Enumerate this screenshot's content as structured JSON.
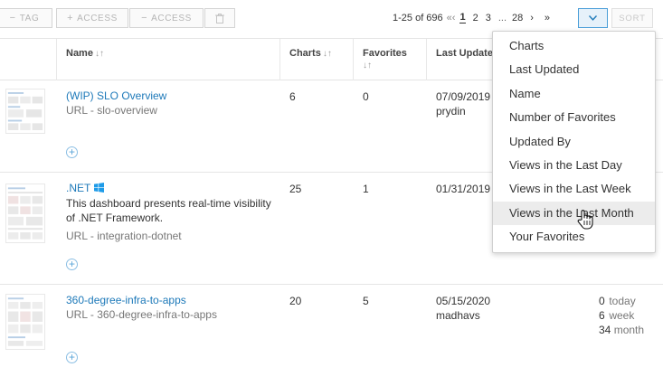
{
  "toolbar": {
    "buttons": [
      {
        "prefix": "−",
        "label": "TAG"
      },
      {
        "prefix": "+",
        "label": "ACCESS"
      },
      {
        "prefix": "−",
        "label": "ACCESS"
      }
    ],
    "delete_icon": "trash-icon"
  },
  "pagination": {
    "range": "1-25 of 696",
    "first": "«",
    "prev": "‹",
    "pages": [
      "1",
      "2",
      "3"
    ],
    "current": "1",
    "ellipsis": "...",
    "last_page": "28",
    "next": "›",
    "last": "»"
  },
  "sort": {
    "toggle_icon": "chevron-down-icon",
    "label": "SORT",
    "accent": "#4a9ed8"
  },
  "columns": {
    "name": "Name",
    "charts": "Charts",
    "favorites": "Favorites",
    "last_updated": "Last Updated",
    "sort_icon": "sort-arrows-icon"
  },
  "rows": [
    {
      "title": "(WIP) SLO Overview",
      "description": "",
      "url": "URL - slo-overview",
      "charts": "6",
      "favorites": "0",
      "updated_date": "07/09/2019",
      "updated_by": "prydin",
      "views": []
    },
    {
      "title": ".NET",
      "title_icon": "windows-logo-icon",
      "description": "This dashboard presents real-time visibility of .NET Framework.",
      "url": "URL - integration-dotnet",
      "charts": "25",
      "favorites": "1",
      "updated_date": "01/31/2019",
      "updated_by": "",
      "views": []
    },
    {
      "title": "360-degree-infra-to-apps",
      "description": "",
      "url": "URL - 360-degree-infra-to-apps",
      "charts": "20",
      "favorites": "5",
      "updated_date": "05/15/2020",
      "updated_by": "madhavs",
      "views": [
        {
          "count": "0",
          "unit": "today"
        },
        {
          "count": "6",
          "unit": "week"
        },
        {
          "count": "34",
          "unit": "month"
        }
      ]
    }
  ],
  "sort_menu": {
    "items": [
      "Charts",
      "Last Updated",
      "Name",
      "Number of Favorites",
      "Updated By",
      "Views in the Last Day",
      "Views in the Last Week",
      "Views in the Last Month",
      "Your Favorites"
    ],
    "hovered": "Views in the Last Month"
  },
  "colors": {
    "link": "#1d79b9",
    "windows_logo": "#1e9be8"
  }
}
